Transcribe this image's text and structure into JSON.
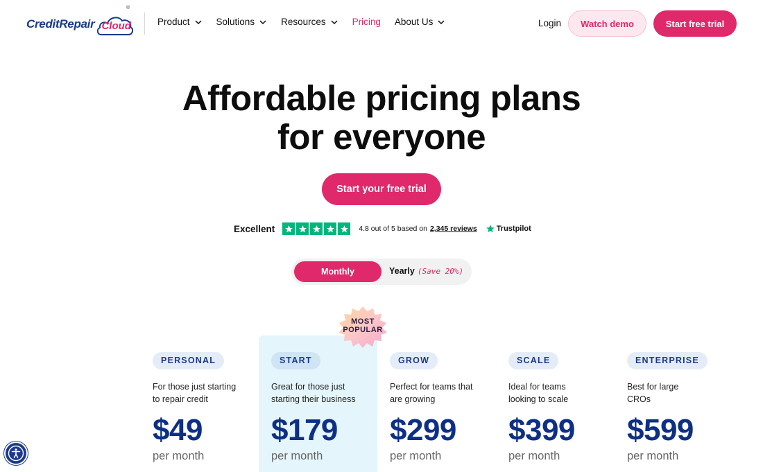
{
  "brand": {
    "name_part1": "CreditRepair",
    "name_part2": "Cloud",
    "registered": "®",
    "primary_color": "#e0296a",
    "navy_color": "#1b3a8c"
  },
  "nav": {
    "items": [
      {
        "label": "Product",
        "has_dropdown": true
      },
      {
        "label": "Solutions",
        "has_dropdown": true
      },
      {
        "label": "Resources",
        "has_dropdown": true
      },
      {
        "label": "Pricing",
        "has_dropdown": false,
        "active": true
      },
      {
        "label": "About Us",
        "has_dropdown": true
      }
    ],
    "login": "Login",
    "watch_demo": "Watch demo",
    "start_trial": "Start free trial"
  },
  "hero": {
    "title_line1": "Affordable pricing plans",
    "title_line2": "for everyone",
    "cta": "Start your free trial"
  },
  "trustpilot": {
    "label": "Excellent",
    "stars": 5,
    "rating_text": "4.8 out of 5 based on",
    "reviews": "2,345 reviews",
    "brand": "Trustpilot",
    "star_color": "#00b67a"
  },
  "billing_toggle": {
    "monthly": "Monthly",
    "yearly": "Yearly",
    "yearly_note": "(Save 20%)",
    "selected": "Monthly"
  },
  "badge": {
    "line1": "MOST",
    "line2": "POPULAR"
  },
  "plans": [
    {
      "tag": "PERSONAL",
      "desc_line1": "For those just starting",
      "desc_line2": "to repair credit",
      "price": "$49",
      "period": "per month"
    },
    {
      "tag": "START",
      "desc_line1": "Great for those just",
      "desc_line2": "starting their business",
      "price": "$179",
      "period": "per month",
      "highlighted": true
    },
    {
      "tag": "GROW",
      "desc_line1": "Perfect for teams that",
      "desc_line2": "are growing",
      "price": "$299",
      "period": "per month"
    },
    {
      "tag": "SCALE",
      "desc_line1": "Ideal for teams",
      "desc_line2": "looking to scale",
      "price": "$399",
      "period": "per month"
    },
    {
      "tag": "ENTERPRISE",
      "desc_line1": "Best for large",
      "desc_line2": "CROs",
      "price": "$599",
      "period": "per month"
    }
  ],
  "accessibility": {
    "icon": "accessibility-icon"
  }
}
